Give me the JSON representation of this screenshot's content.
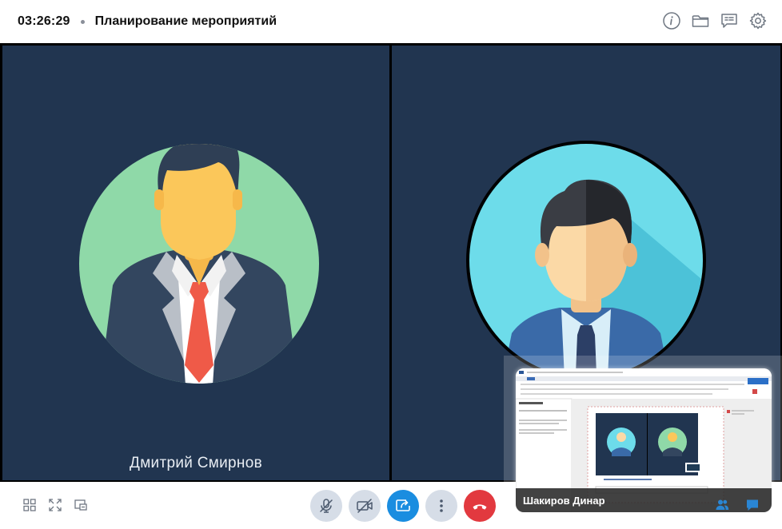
{
  "header": {
    "timer": "03:26:29",
    "title": "Планирование мероприятий",
    "icons": [
      "info-icon",
      "folder-icon",
      "chat-list-icon",
      "gear-icon"
    ]
  },
  "participants": [
    {
      "name": "Дмитрий Смирнов"
    },
    {
      "name": ""
    }
  ],
  "screen_share": {
    "name": "Шакиров Динар"
  },
  "bottom_bar": {
    "left_icons": [
      "grid-layout-icon",
      "fullscreen-icon",
      "picture-in-picture-icon"
    ],
    "controls": [
      "mute-microphone-icon",
      "camera-off-icon",
      "share-screen-icon",
      "more-icon",
      "end-call-icon"
    ],
    "right_icons": [
      "participants-icon",
      "chat-icon"
    ]
  },
  "colors": {
    "tile_bg": "#213550",
    "accent_blue": "#1a8de0",
    "end_call_red": "#e2393f",
    "control_gray": "#d6dde7",
    "icon_blue": "#2a86d4"
  }
}
